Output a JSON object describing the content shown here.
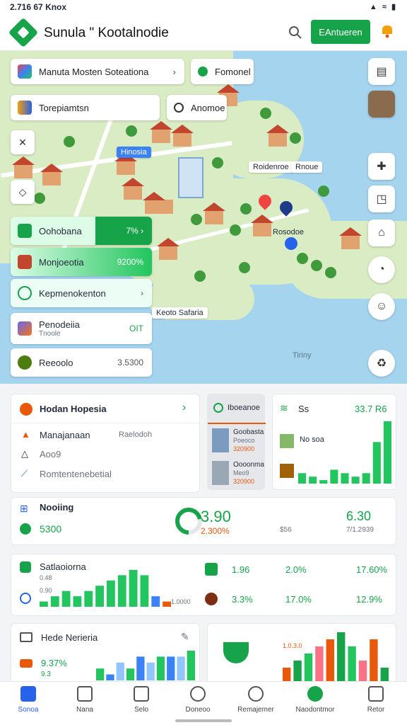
{
  "status": {
    "time": "2.716 67",
    "carrier": "Knox",
    "icons": "▲ ≈ ▮"
  },
  "app": {
    "title": "Sunula \" Kootalnodie",
    "cta": "EAntueren"
  },
  "map": {
    "chips": [
      {
        "label": "Manuta Mosten Soteationa",
        "chevron": "›"
      },
      {
        "label": "Fomonel"
      },
      {
        "label": "Torepiamtsn"
      },
      {
        "label": "Anomoe"
      }
    ],
    "labels": [
      "Hinosia",
      "Roidenroe",
      "Rnoue",
      "Rosodoe",
      "Keoto Safaria",
      "Tiriny"
    ],
    "list": [
      {
        "label": "Oohobana",
        "value": "7% ›"
      },
      {
        "label": "Monjoeotia",
        "value": "9200%"
      },
      {
        "label": "Kepmenokenton",
        "value": "›"
      },
      {
        "label": "Penodeiia",
        "sub": "Tnoole",
        "value": "OIT"
      },
      {
        "label": "Reeoolo",
        "value": "3.5300"
      }
    ]
  },
  "dashboard": {
    "hub": {
      "title": "Hodan Hopesia",
      "rows": [
        "Manajanaan",
        "Aoo9",
        "Romtentenebetial"
      ],
      "row_note": "Raelodoh"
    },
    "media": {
      "header": "Iboeanoe",
      "items": [
        {
          "title": "Goobasta",
          "sub": "Poeoco",
          "value": "320900"
        },
        {
          "title": "Oooonma",
          "sub": "Meo9",
          "value": "320900"
        }
      ]
    },
    "mini_chart": {
      "title": "Ss",
      "value": "33.7 R6",
      "item": "No soa",
      "bars": [
        3,
        2,
        1,
        4,
        3,
        2,
        3,
        12,
        18
      ]
    },
    "progress": {
      "title": "Nooiing",
      "value": "5300",
      "gauge_value": "3.90",
      "gauge_sub": "2.300%",
      "mid": "$56",
      "right_value": "6.30",
      "right_sub": "7/1.2939",
      "gauge_fraction": 0.72
    },
    "stats": {
      "title": "Satlaoiorna",
      "sub": "0.48",
      "axis": "0.90",
      "end": "1.0000",
      "bars": [
        1,
        2,
        3,
        2,
        3,
        4,
        5,
        6,
        7,
        6,
        2,
        1
      ],
      "rows": [
        {
          "v1": "1.96",
          "v2": "2.0%",
          "v3": "17.60%"
        },
        {
          "v1": "3.3%",
          "v2": "17.0%",
          "v3": "12.9%"
        }
      ]
    },
    "bottom_left": {
      "title": "Hede Nerieria",
      "value": "9.37%",
      "sub": "9.3",
      "bars": [
        2,
        1,
        3,
        2,
        4,
        3,
        4,
        4,
        4,
        5
      ]
    },
    "bottom_right": {
      "label": "1.0.3.0",
      "bars": [
        2,
        3,
        4,
        5,
        6,
        7,
        5,
        3,
        6,
        2
      ]
    }
  },
  "nav": [
    {
      "label": "Sonoa",
      "active": true
    },
    {
      "label": "Nana"
    },
    {
      "label": "Selo"
    },
    {
      "label": "Doneoo"
    },
    {
      "label": "Remajemer"
    },
    {
      "label": "Naodontmor"
    },
    {
      "label": "Retor"
    }
  ],
  "colors": {
    "brand": "#16a34a",
    "accent": "#2563eb",
    "warn": "#ea580c",
    "map_water": "#a5d4ef"
  }
}
